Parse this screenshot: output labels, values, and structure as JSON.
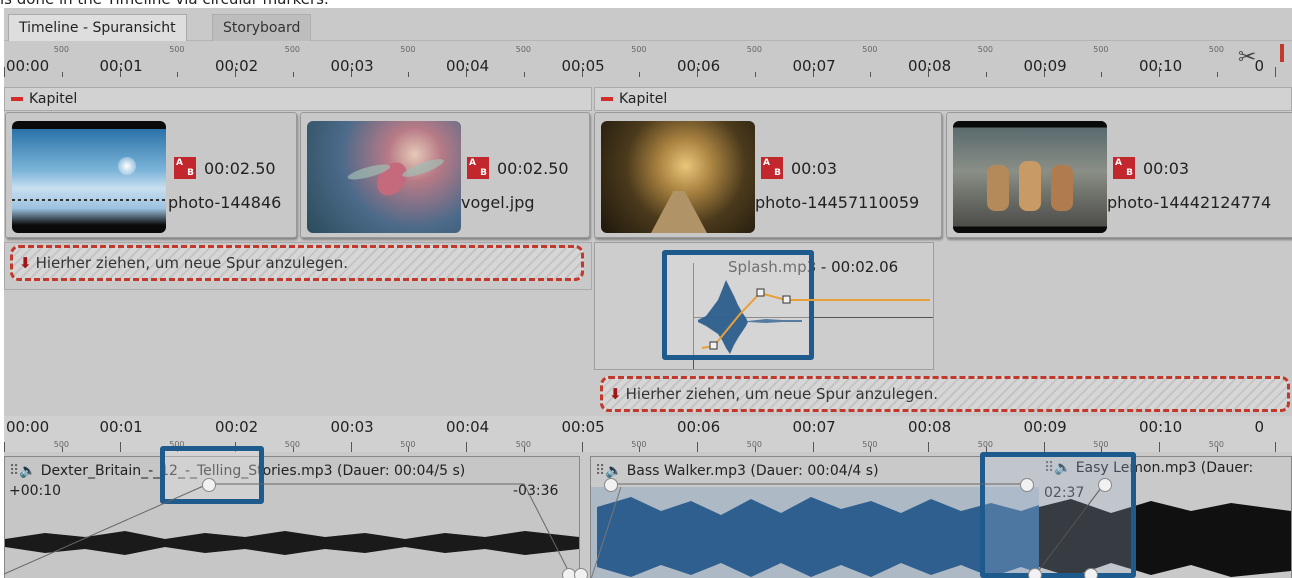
{
  "page_fragment": "is done in the Timeline via circular markers.",
  "tabs": {
    "active": "Timeline - Spuransicht",
    "inactive": "Storyboard"
  },
  "ruler": {
    "major": [
      "00:00",
      "00:01",
      "00:02",
      "00:03",
      "00:04",
      "00:05",
      "00:06",
      "00:07",
      "00:08",
      "00:09",
      "00:10",
      "0"
    ],
    "minor": "500"
  },
  "chapters": [
    {
      "label": "Kapitel"
    },
    {
      "label": "Kapitel"
    }
  ],
  "clips": [
    {
      "duration": "00:02.50",
      "filename": "photo-144846"
    },
    {
      "duration": "00:02.50",
      "filename": "vogel.jpg"
    },
    {
      "duration": "00:03",
      "filename": "photo-14457110059"
    },
    {
      "duration": "00:03",
      "filename": "photo-14442124774"
    }
  ],
  "drop_text": "Hierher ziehen, um neue Spur anzulegen.",
  "splash_label": "Splash.mp3 - 00:02.06",
  "audio_tracks": [
    {
      "title": "Dexter_Britain_-_12_-_Telling_Stories.mp3 (Dauer: 00:04/5 s)",
      "offset": "+00:10",
      "end_time": "-03:36"
    },
    {
      "title": "Bass Walker.mp3 (Dauer: 00:04/4 s)"
    },
    {
      "title": "Easy Lemon.mp3 (Dauer:",
      "time": "02:37"
    }
  ],
  "colors": {
    "accent_blue": "#1f5a8d",
    "drop_border": "#c0392b",
    "volume_line": "#e8a03a",
    "waveform": "#2e5f8e"
  },
  "icons": [
    "chapter-collapse-icon",
    "transition-ab-icon",
    "speaker-icon",
    "drag-grip-icon",
    "scissors-icon",
    "drop-arrow-icon"
  ]
}
